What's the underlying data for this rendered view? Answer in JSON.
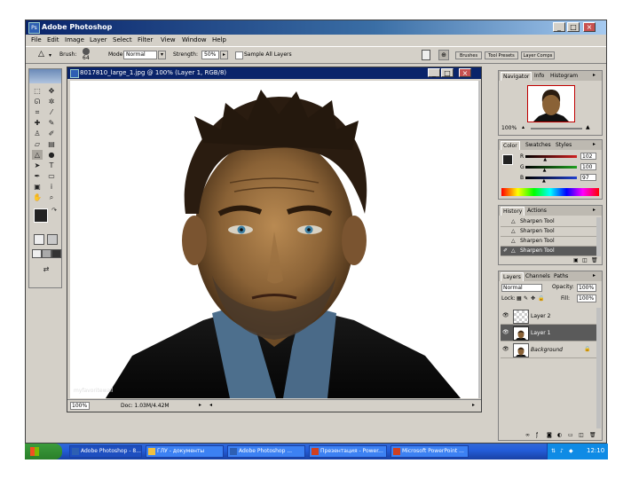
{
  "app": {
    "title": "Adobe Photoshop",
    "logo_text": "Ps",
    "menus": [
      "File",
      "Edit",
      "Image",
      "Layer",
      "Select",
      "Filter",
      "View",
      "Window",
      "Help"
    ]
  },
  "options_bar": {
    "brush_label": "Brush:",
    "brush_size": "64",
    "mode_label": "Mode:",
    "mode_value": "Normal",
    "strength_label": "Strength:",
    "strength_value": "50%",
    "sample_all_label": "Sample All Layers",
    "well_tabs": [
      "Brushes",
      "Tool Presets",
      "Layer Comps"
    ]
  },
  "document": {
    "title": "8017810_large_1.jpg @ 100% (Layer 1, RGB/8)",
    "zoom": "100%",
    "doc_info": "Doc: 1.03M/4.42M",
    "watermark": "myfavoritewall"
  },
  "navigator": {
    "tabs": [
      "Navigator",
      "Info",
      "Histogram"
    ],
    "zoom": "100%"
  },
  "color_panel": {
    "tabs": [
      "Color",
      "Swatches",
      "Styles"
    ],
    "channels": [
      {
        "label": "R",
        "value": "102",
        "level": 0.4,
        "color": "#d02020"
      },
      {
        "label": "G",
        "value": "100",
        "level": 0.39,
        "color": "#20a020"
      },
      {
        "label": "B",
        "value": "97",
        "level": 0.38,
        "color": "#2040d0"
      }
    ]
  },
  "history_panel": {
    "tabs": [
      "History",
      "Actions"
    ],
    "items": [
      {
        "label": "Sharpen Tool",
        "selected": false
      },
      {
        "label": "Sharpen Tool",
        "selected": false
      },
      {
        "label": "Sharpen Tool",
        "selected": false
      },
      {
        "label": "Sharpen Tool",
        "selected": true
      }
    ]
  },
  "layers_panel": {
    "tabs": [
      "Layers",
      "Channels",
      "Paths"
    ],
    "blend_mode": "Normal",
    "opacity_label": "Opacity:",
    "opacity_value": "100%",
    "lock_label": "Lock:",
    "fill_label": "Fill:",
    "fill_value": "100%",
    "layers": [
      {
        "name": "Layer 2",
        "selected": false,
        "visible": true,
        "transparent": true
      },
      {
        "name": "Layer 1",
        "selected": true,
        "visible": true,
        "transparent": false
      },
      {
        "name": "Background",
        "selected": false,
        "visible": true,
        "transparent": false,
        "locked": true
      }
    ]
  },
  "taskbar": {
    "items": [
      {
        "label": "Adobe Photoshop - 8...",
        "active": true
      },
      {
        "label": "ГЛУ - документы",
        "active": false
      },
      {
        "label": "Adobe Photoshop ...",
        "active": false
      },
      {
        "label": "Презентация - Power...",
        "active": false
      },
      {
        "label": "Microsoft PowerPoint ...",
        "active": false
      }
    ],
    "clock": "12:10"
  }
}
